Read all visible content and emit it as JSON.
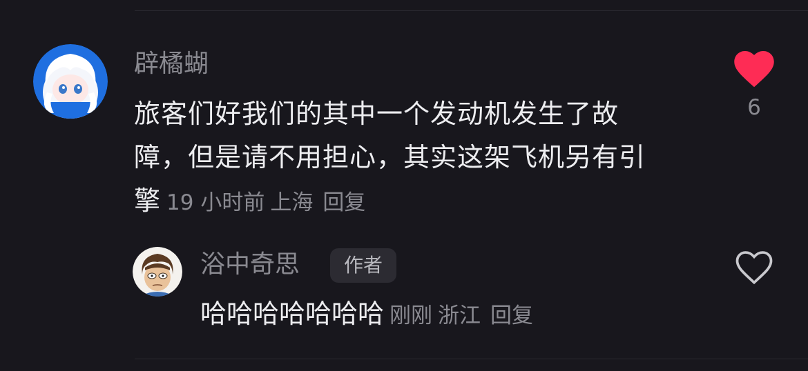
{
  "comment": {
    "username": "辟橘蝴",
    "text_line1": "旅客们好我们的其中一个发动机发生了故",
    "text_line2": "障，但是请不用担心，其实这架飞机另有引",
    "text_line3": "擎",
    "time": "19 小时前",
    "location": "上海",
    "reply_label": "回复",
    "like_count": "6",
    "liked": true,
    "like_icon": "heart-filled-icon",
    "accent_color": "#fe2c55"
  },
  "reply": {
    "username": "浴中奇思",
    "author_badge": "作者",
    "text": "哈哈哈哈哈哈哈",
    "time": "刚刚",
    "location": "浙江",
    "reply_label": "回复",
    "liked": false,
    "like_icon": "heart-outline-icon"
  }
}
